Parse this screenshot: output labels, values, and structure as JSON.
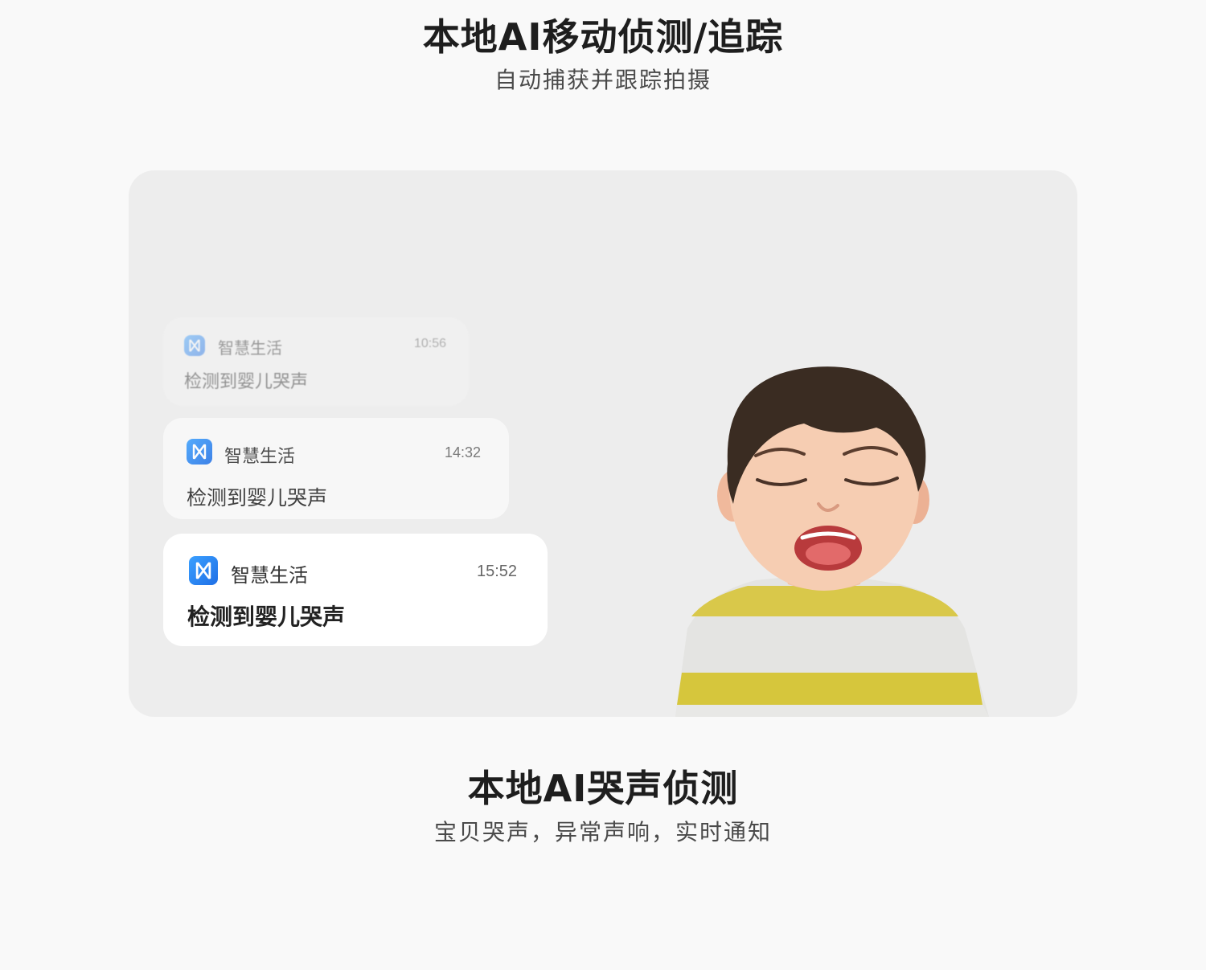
{
  "header": {
    "title": "本地AI移动侦测/追踪",
    "subtitle": "自动捕获并跟踪拍摄"
  },
  "notifications": [
    {
      "app_name": "智慧生活",
      "time": "10:56",
      "message": "检测到婴儿哭声",
      "icon": "smart-life-app-icon"
    },
    {
      "app_name": "智慧生活",
      "time": "14:32",
      "message": "检测到婴儿哭声",
      "icon": "smart-life-app-icon"
    },
    {
      "app_name": "智慧生活",
      "time": "15:52",
      "message": "检测到婴儿哭声",
      "icon": "smart-life-app-icon"
    }
  ],
  "footer": {
    "title": "本地AI哭声侦测",
    "subtitle": "宝贝哭声，异常声响，实时通知"
  },
  "colors": {
    "background": "#f9f9f9",
    "panel": "#ededed",
    "accent_blue": "#1f7ae8",
    "shirt_yellow": "#d8c63a"
  }
}
